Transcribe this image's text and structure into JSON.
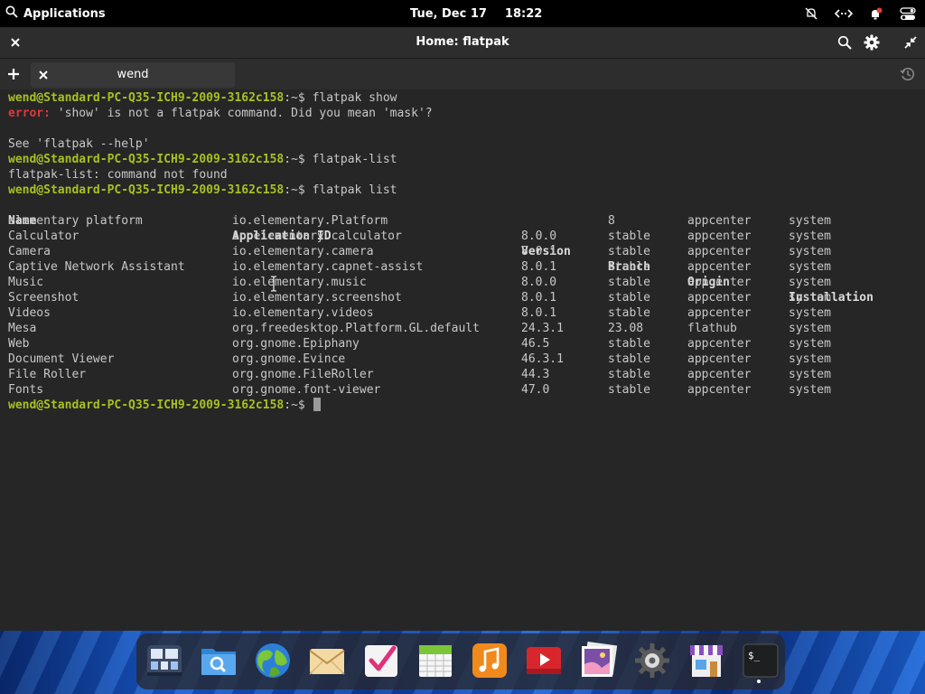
{
  "top_panel": {
    "applications_label": "Applications",
    "date": "Tue, Dec 17",
    "time": "18:22",
    "icons": [
      "search-icon",
      "notifications-off-icon",
      "network-wired-icon",
      "notification-bell-icon",
      "system-toggles-icon"
    ]
  },
  "window": {
    "title": "Home: flatpak",
    "icons": [
      "close-icon",
      "search-icon",
      "gear-icon",
      "restore-icon"
    ]
  },
  "tabs": {
    "new_tab_icon": "plus-icon",
    "items": [
      {
        "label": "wend"
      }
    ],
    "history_icon": "history-icon"
  },
  "terminal": {
    "prompt": "wend@Standard-PC-Q35-ICH9-2009-3162c158",
    "prompt_suffix": ":~$ ",
    "lines": {
      "cmd1": "flatpak show",
      "error_label": "error:",
      "error_text": " 'show' is not a flatpak command. Did you mean 'mask'?",
      "help_hint": "See 'flatpak --help'",
      "cmd2": "flatpak-list",
      "not_found": "flatpak-list: command not found",
      "cmd3": "flatpak list"
    },
    "table": {
      "headers": [
        "Name",
        "Application ID",
        "Version",
        "Branch",
        "Origin",
        "Installation"
      ],
      "rows": [
        [
          "elementary platform",
          "io.elementary.Platform",
          "",
          "8",
          "appcenter",
          "system"
        ],
        [
          "Calculator",
          "io.elementary.calculator",
          "8.0.0",
          "stable",
          "appcenter",
          "system"
        ],
        [
          "Camera",
          "io.elementary.camera",
          "8.0.1",
          "stable",
          "appcenter",
          "system"
        ],
        [
          "Captive Network Assistant",
          "io.elementary.capnet-assist",
          "8.0.1",
          "stable",
          "appcenter",
          "system"
        ],
        [
          "Music",
          "io.elementary.music",
          "8.0.0",
          "stable",
          "appcenter",
          "system"
        ],
        [
          "Screenshot",
          "io.elementary.screenshot",
          "8.0.1",
          "stable",
          "appcenter",
          "system"
        ],
        [
          "Videos",
          "io.elementary.videos",
          "8.0.1",
          "stable",
          "appcenter",
          "system"
        ],
        [
          "Mesa",
          "org.freedesktop.Platform.GL.default",
          "24.3.1",
          "23.08",
          "flathub",
          "system"
        ],
        [
          "Web",
          "org.gnome.Epiphany",
          "46.5",
          "stable",
          "appcenter",
          "system"
        ],
        [
          "Document Viewer",
          "org.gnome.Evince",
          "46.3.1",
          "stable",
          "appcenter",
          "system"
        ],
        [
          "File Roller",
          "org.gnome.FileRoller",
          "44.3",
          "stable",
          "appcenter",
          "system"
        ],
        [
          "Fonts",
          "org.gnome.font-viewer",
          "47.0",
          "stable",
          "appcenter",
          "system"
        ]
      ]
    }
  },
  "dock": {
    "apps": [
      {
        "icon": "multitasking-view-icon"
      },
      {
        "icon": "files-icon"
      },
      {
        "icon": "web-browser-icon"
      },
      {
        "icon": "mail-icon"
      },
      {
        "icon": "tasks-icon"
      },
      {
        "icon": "calendar-icon"
      },
      {
        "icon": "music-icon"
      },
      {
        "icon": "videos-icon"
      },
      {
        "icon": "photos-icon"
      },
      {
        "icon": "system-settings-icon"
      },
      {
        "icon": "appcenter-icon"
      },
      {
        "icon": "terminal-icon",
        "running": true,
        "terminal_glyph": "$_"
      }
    ]
  },
  "colors": {
    "prompt_user": "#a8c023",
    "error": "#e03838",
    "terminal_bg": "#262626",
    "terminal_fg": "#c8c8c8"
  }
}
